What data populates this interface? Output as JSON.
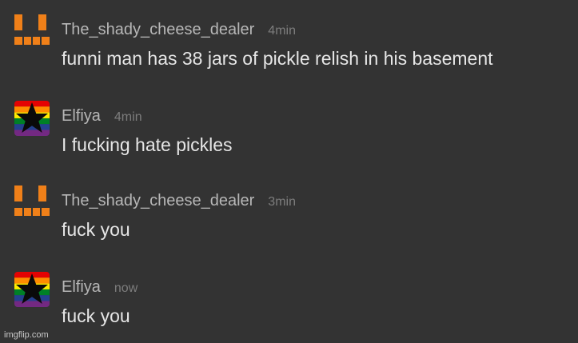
{
  "messages": [
    {
      "username": "The_shady_cheese_dealer",
      "time": "4min",
      "text": "funni man has 38 jars of pickle relish in his basement",
      "avatar": "orange-face-avatar"
    },
    {
      "username": "Elfiya",
      "time": "4min",
      "text": "I fucking hate pickles",
      "avatar": "rainbow-star-avatar"
    },
    {
      "username": "The_shady_cheese_dealer",
      "time": "3min",
      "text": "fuck you",
      "avatar": "orange-face-avatar"
    },
    {
      "username": "Elfiya",
      "time": "now",
      "text": "fuck you",
      "avatar": "rainbow-star-avatar"
    }
  ],
  "watermark": "imgflip.com",
  "colors": {
    "background": "#333333",
    "username": "#b7b7b7",
    "timestamp": "#7d7d7d",
    "message_text": "#e6e6e6",
    "orange_avatar": "#f08019"
  }
}
